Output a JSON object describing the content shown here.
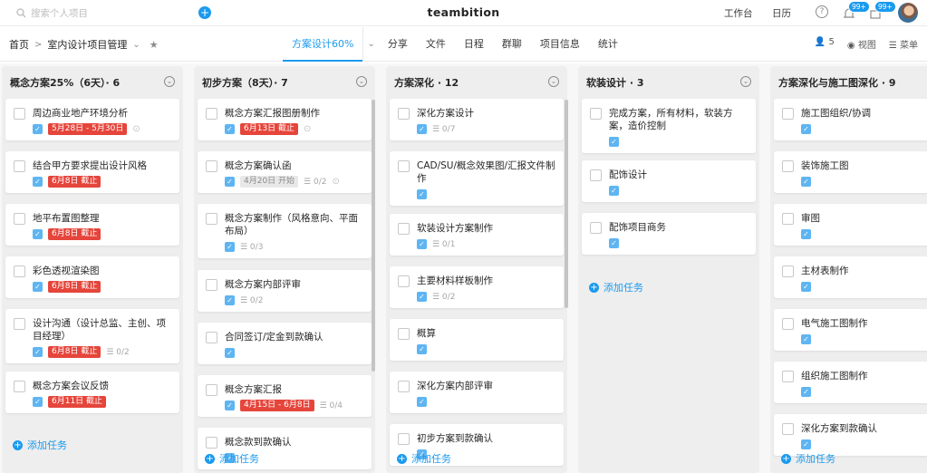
{
  "topbar": {
    "search_placeholder": "搜索个人项目",
    "brand": "teambition",
    "workbench": "工作台",
    "calendar": "日历",
    "help": "?",
    "badge1": "99+",
    "badge2": "99+"
  },
  "subbar": {
    "home": "首页",
    "project": "室内设计项目管理",
    "members": "5",
    "view": "视图",
    "menu": "菜单"
  },
  "tabs": [
    "方案设计60%",
    "分享",
    "文件",
    "日程",
    "群聊",
    "项目信息",
    "统计"
  ],
  "add_task": "添加任务",
  "columns": [
    {
      "title": "概念方案25%（6天）· 6",
      "cards": [
        {
          "title": "周边商业地产环境分析",
          "due": "5月28日 - 5月30日",
          "link": true
        },
        {
          "title": "结合甲方要求提出设计风格",
          "due": "6月8日 截止"
        },
        {
          "title": "地平布置图整理",
          "due": "6月8日 截止"
        },
        {
          "title": "彩色透视渲染图",
          "due": "6月8日 截止"
        },
        {
          "title": "设计沟通（设计总监、主创、项目经理）",
          "due": "6月8日 截止",
          "sub": "0/2"
        },
        {
          "title": "概念方案会议反馈",
          "due": "6月11日 截止"
        }
      ]
    },
    {
      "title": "初步方案（8天）· 7",
      "cards": [
        {
          "title": "概念方案汇报图册制作",
          "due": "6月13日 截止",
          "link": true
        },
        {
          "title": "概念方案确认函",
          "due_gray": "4月20日 开始",
          "sub": "0/2",
          "link": true
        },
        {
          "title": "概念方案制作（风格意向、平面布局）",
          "sub": "0/3"
        },
        {
          "title": "概念方案内部评审",
          "sub": "0/2"
        },
        {
          "title": "合同签订/定金到款确认"
        },
        {
          "title": "概念方案汇报",
          "due": "4月15日 - 6月8日",
          "sub": "0/4"
        },
        {
          "title": "概念款到款确认"
        }
      ]
    },
    {
      "title": "方案深化 · 12",
      "cards": [
        {
          "title": "深化方案设计",
          "sub": "0/7"
        },
        {
          "title": "CAD/SU/概念效果图/汇报文件制作"
        },
        {
          "title": "软装设计方案制作",
          "sub": "0/1"
        },
        {
          "title": "主要材料样板制作",
          "sub": "0/2"
        },
        {
          "title": "概算"
        },
        {
          "title": "深化方案内部评审"
        },
        {
          "title": "初步方案到款确认"
        }
      ]
    },
    {
      "title": "软装设计 · 3",
      "cards": [
        {
          "title": "完成方案，所有材料，软装方案，造价控制"
        },
        {
          "title": "配饰设计"
        },
        {
          "title": "配饰项目商务"
        }
      ]
    },
    {
      "title": "方案深化与施工图深化 · 9",
      "cards": [
        {
          "title": "施工图组织/协调"
        },
        {
          "title": "装饰施工图"
        },
        {
          "title": "审图"
        },
        {
          "title": "主材表制作"
        },
        {
          "title": "电气施工图制作"
        },
        {
          "title": "组织施工图制作"
        },
        {
          "title": "深化方案到款确认"
        }
      ]
    }
  ],
  "colors": {
    "accent": "#1b9aee",
    "due_red": "#e5453b",
    "check": "#5eb5f2"
  }
}
